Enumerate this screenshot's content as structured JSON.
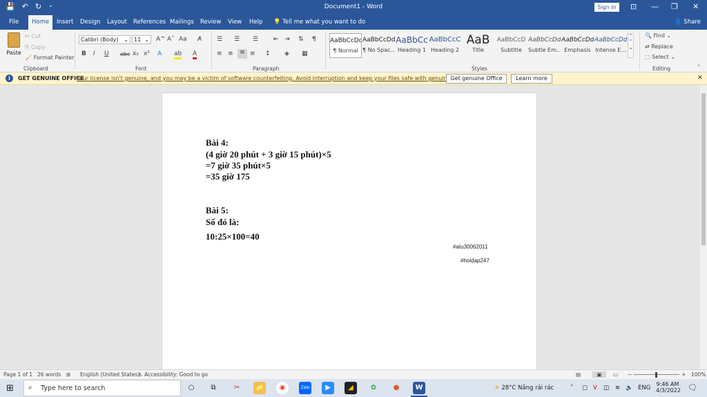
{
  "window": {
    "title": "Document1  -  Word",
    "signin_label": "Sign in",
    "qat": [
      "save-icon",
      "undo-icon",
      "redo-icon"
    ]
  },
  "tabs": [
    {
      "label": "File"
    },
    {
      "label": "Home",
      "active": true
    },
    {
      "label": "Insert"
    },
    {
      "label": "Design"
    },
    {
      "label": "Layout"
    },
    {
      "label": "References"
    },
    {
      "label": "Mailings"
    },
    {
      "label": "Review"
    },
    {
      "label": "View"
    },
    {
      "label": "Help"
    }
  ],
  "tellme": "Tell me what you want to do",
  "share": "Share",
  "clipboard": {
    "paste": "Paste",
    "cut": "Cut",
    "copy": "Copy",
    "format_painter": "Format Painter",
    "label": "Clipboard"
  },
  "font": {
    "name": "Calibri (Body)",
    "size": "11",
    "label": "Font",
    "bold": "B",
    "italic": "I",
    "underline": "U",
    "strike": "abc",
    "sub": "x₂",
    "sup": "x²",
    "grow": "A^",
    "shrink": "Aˇ",
    "case": "Aa"
  },
  "paragraph": {
    "label": "Paragraph",
    "pilcrow": "¶"
  },
  "styles": {
    "label": "Styles",
    "items": [
      {
        "preview": "AaBbCcDd",
        "name": "¶ Normal"
      },
      {
        "preview": "AaBbCcDd",
        "name": "¶ No Spac..."
      },
      {
        "preview": "AaBbCc",
        "name": "Heading 1"
      },
      {
        "preview": "AaBbCcC",
        "name": "Heading 2"
      },
      {
        "preview": "AaB",
        "name": "Title"
      },
      {
        "preview": "AaBbCcD",
        "name": "Subtitle"
      },
      {
        "preview": "AaBbCcDd",
        "name": "Subtle Em..."
      },
      {
        "preview": "AaBbCcDd",
        "name": "Emphasis"
      },
      {
        "preview": "AaBbCcDd",
        "name": "Intense E..."
      }
    ]
  },
  "editing": {
    "find": "Find",
    "replace": "Replace",
    "select": "Select",
    "label": "Editing"
  },
  "notice": {
    "head": "GET GENUINE OFFICE",
    "message": "Your license isn't genuine, and you may be a victim of software counterfeiting. Avoid interruption and keep your files safe with genuine Office today.",
    "get_button": "Get genuine Office",
    "learn_button": "Learn more"
  },
  "document": {
    "lines": [
      "Bài 4:",
      "(4 giờ 20 phút + 3 giờ 15 phút)×5",
      "=7 giờ 35 phút×5",
      "=35 giờ 175",
      "Bài 5:",
      "Số đó là:",
      "10:25×100=40"
    ],
    "tag1": "#atu30062011",
    "tag2": "#hoidap247"
  },
  "status": {
    "page": "Page 1 of 1",
    "words": "26 words",
    "language": "English (United States)",
    "accessibility": "Accessibility: Good to go",
    "zoom": "100%"
  },
  "taskbar": {
    "search_placeholder": "Type here to search",
    "weather": "28°C  Nắng rải rác",
    "lang": "ENG",
    "time": "9:46 AM",
    "date": "4/3/2022"
  }
}
